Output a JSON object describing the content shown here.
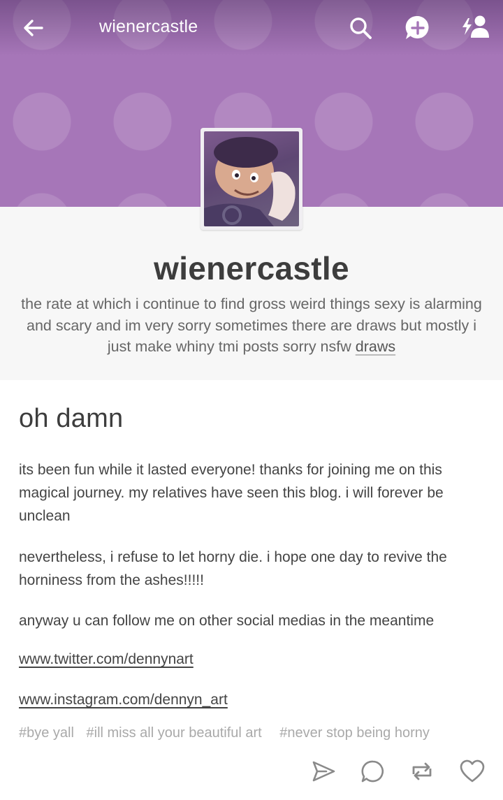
{
  "header": {
    "title": "wienercastle",
    "back_icon": "back-arrow-icon",
    "search_icon": "search-icon",
    "ask_icon": "plus-bubble-icon",
    "follow_icon": "follow-user-icon"
  },
  "profile": {
    "name": "wienercastle",
    "description": "the rate at which i continue to find gross weird things sexy is alarming and scary and im very sorry sometimes there are draws but mostly i just make whiny tmi posts sorry nsfw ",
    "description_link": "draws"
  },
  "post": {
    "title": "oh damn",
    "paragraphs": [
      "its been fun while it lasted everyone! thanks for joining me on this magical journey. my relatives have seen this blog. i will forever be unclean",
      "nevertheless, i refuse to let horny die. i hope one day to revive the horniness from the ashes!!!!!",
      "anyway u can follow me on other social medias in the meantime"
    ],
    "links": [
      "www.twitter.com/dennynart",
      "www.instagram.com/dennyn_art"
    ],
    "tags": [
      "#bye yall",
      "#ill miss all your beautiful art",
      "#never stop being horny"
    ]
  },
  "actions": {
    "share_icon": "share-icon",
    "reply_icon": "reply-icon",
    "reblog_icon": "reblog-icon",
    "like_icon": "heart-icon"
  },
  "colors": {
    "banner": "#a676b8",
    "background": "#f7f7f7",
    "text": "#444444",
    "tag_text": "#a9a9a9"
  }
}
